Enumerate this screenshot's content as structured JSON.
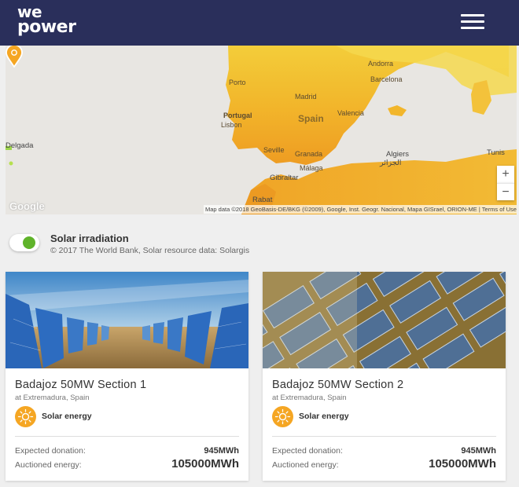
{
  "header": {
    "logo_line1": "we",
    "logo_line2": "power",
    "menu_icon": "hamburger-icon",
    "background_color": "#2a2f5b"
  },
  "map": {
    "labels": {
      "andorra": "Andorra",
      "porto": "Porto",
      "barcelona": "Barcelona",
      "madrid": "Madrid",
      "portugal": "Portugal",
      "lisbon": "Lisbon",
      "spain": "Spain",
      "valencia": "Valencia",
      "ponta_delgada": "Delgada",
      "seville": "Seville",
      "granada": "Granada",
      "algiers": "Algiers",
      "algiers_arabic": "الجزائر",
      "tunis": "Tunis",
      "malaga": "Málaga",
      "gibraltar": "Gibraltar",
      "rabat": "Rabat"
    },
    "zoom_in_label": "+",
    "zoom_out_label": "−",
    "google_logo": "Google",
    "attribution": "Map data ©2018 GeoBasis-DE/BKG (©2009), Google, Inst. Geogr. Nacional, Mapa GISrael, ORION-ME | Terms of Use",
    "marker_icon": "solar-pin-icon"
  },
  "layer": {
    "enabled": true,
    "title": "Solar irradiation",
    "credit": "© 2017 The World Bank, Solar resource data: Solargis",
    "accent_color": "#5fb32a"
  },
  "projects": [
    {
      "name": "Badajoz 50MW Section 1",
      "location": "at Extremadura, Spain",
      "energy_icon": "sun-icon",
      "energy_type": "Solar energy",
      "donation_label": "Expected donation:",
      "donation_value": "945MWh",
      "auctioned_label": "Auctioned energy:",
      "auctioned_value": "105000MWh"
    },
    {
      "name": "Badajoz 50MW Section 2",
      "location": "at Extremadura, Spain",
      "energy_icon": "sun-icon",
      "energy_type": "Solar energy",
      "donation_label": "Expected donation:",
      "donation_value": "945MWh",
      "auctioned_label": "Auctioned energy:",
      "auctioned_value": "105000MWh"
    }
  ],
  "colors": {
    "energy_badge": "#f5a623",
    "card_background": "#ffffff",
    "page_background": "#efefef"
  }
}
